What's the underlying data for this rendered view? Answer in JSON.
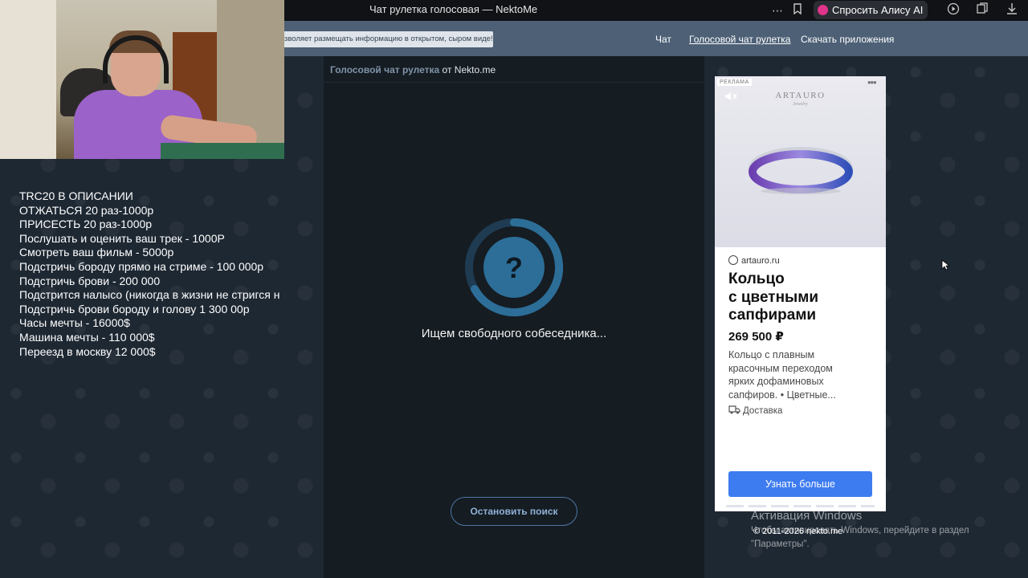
{
  "browser": {
    "tab_title": "Чат рулетка голосовая — NektoMe",
    "more_glyph": "⋯",
    "alice_label": "Спросить Алису AI"
  },
  "nav": {
    "notice": "зволяет размещать информацию в открытом, сыром виде!",
    "links": [
      "Чат",
      "Голосовой чат рулетка",
      "Скачать приложения"
    ],
    "active_index": 1
  },
  "overlay": {
    "lines": [
      "TRC20 В ОПИСАНИИ",
      "ОТЖАТЬСЯ 20 раз-1000р",
      "ПРИСЕСТЬ 20 раз-1000р",
      "Послушать и оценить ваш трек - 1000Р",
      "Смотреть ваш фильм - 5000р",
      "Подстричь бороду прямо на стриме - 100 000р",
      "Подстричь брови - 200 000",
      "Подстрится налысо (никогда в жизни не стригся н",
      "Подстричь брови бороду и голову 1 300 00р",
      "Часы мечты - 16000$",
      "Машина мечты - 110 000$",
      "Переезд в москву 12 000$"
    ]
  },
  "chat": {
    "crumb_link": "Голосовой чат рулетка",
    "crumb_rest": " от Nekto.me",
    "spinner_glyph": "?",
    "status": "Ищем свободного собеседника...",
    "stop_button": "Остановить поиск"
  },
  "ad": {
    "badge": "РЕКЛАМА",
    "more": "•••",
    "brand": "ARTAURO",
    "brand_sub": "Jewelry",
    "domain": "artauro.ru",
    "title_lines": [
      "Кольцо",
      "с цветными",
      "сапфирами"
    ],
    "price": "269 500 ₽",
    "desc_lines": [
      "Кольцо с плавным",
      "красочным переходом",
      "ярких дофаминовых",
      "сапфиров. • Цветные..."
    ],
    "delivery": "Доставка",
    "cta": "Узнать больше"
  },
  "footer": {
    "wm_title": "Активация Windows",
    "wm_line1": "Чтобы активировать Windows, перейдите в раздел",
    "wm_line2": "\"Параметры\".",
    "copyright": "© 2011-2026 nekto.me"
  },
  "colors": {
    "nav_bg": "#4d6076",
    "chat_bg": "#151c22",
    "accent": "#3d7bf0",
    "spinner": "#2c6e98"
  }
}
